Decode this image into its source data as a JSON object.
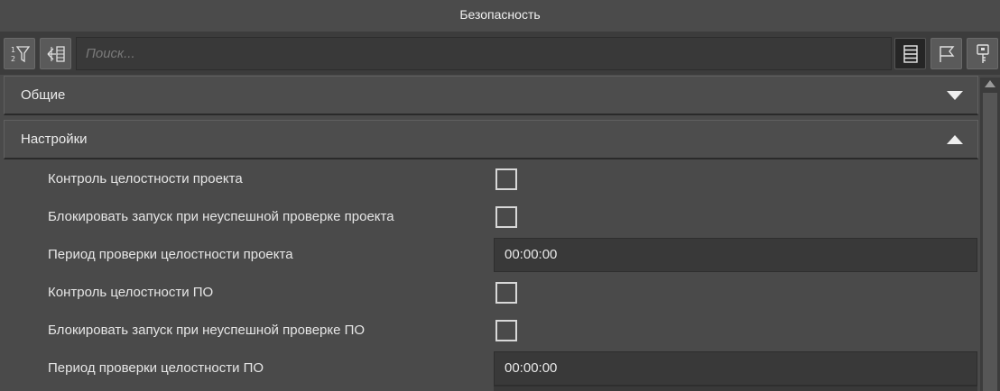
{
  "window": {
    "title": "Безопасность"
  },
  "toolbar": {
    "search_placeholder": "Поиск...",
    "icons": [
      "sort-filter-icon",
      "expand-collapse-icon",
      "list-view-icon",
      "flag-icon",
      "key-icon"
    ]
  },
  "sections": [
    {
      "title": "Общие",
      "state": "collapsed"
    },
    {
      "title": "Настройки",
      "state": "expanded"
    }
  ],
  "settings": {
    "project_integrity_control": {
      "label": "Контроль целостности проекта",
      "checked": false
    },
    "block_on_project_fail": {
      "label": "Блокировать запуск при неуспешной проверке проекта",
      "checked": false
    },
    "project_check_period": {
      "label": "Период проверки целостности проекта",
      "value": "00:00:00"
    },
    "software_integrity_control": {
      "label": "Контроль целостности ПО",
      "checked": false
    },
    "block_on_software_fail": {
      "label": "Блокировать запуск при неуспешной проверке ПО",
      "checked": false
    },
    "software_check_period": {
      "label": "Период проверки целостности ПО",
      "value": "00:00:00"
    }
  },
  "colors": {
    "background": "#4a4a4a",
    "toolbar": "#3c3c3c",
    "field": "#393939",
    "text": "#e6e6e6"
  }
}
